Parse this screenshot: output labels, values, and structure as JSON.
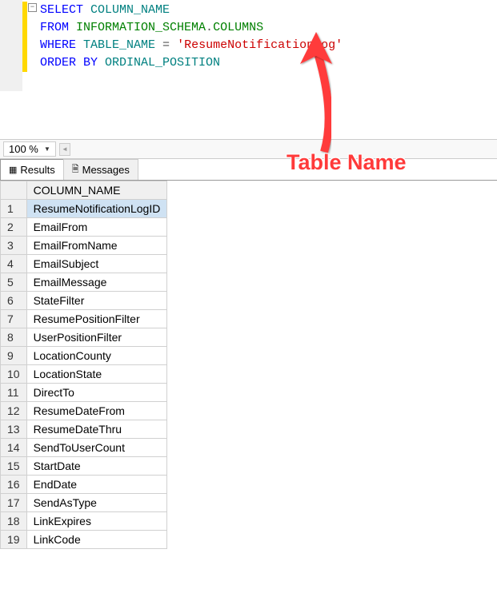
{
  "code": {
    "line1": {
      "select": "SELECT",
      "col": " COLUMN_NAME"
    },
    "line2": {
      "from": "FROM",
      "schema": " INFORMATION_SCHEMA",
      "dot": ".",
      "cols": "COLUMNS"
    },
    "line3": {
      "where": "WHERE",
      "tbl": " TABLE_NAME ",
      "eq": "=",
      "sp": " ",
      "str": "'ResumeNotificationLog'"
    },
    "line4": {
      "orderby": "ORDER BY",
      "ord": " ORDINAL_POSITION"
    }
  },
  "zoom": {
    "value": "100 %"
  },
  "tabs": {
    "results": "Results",
    "messages": "Messages"
  },
  "grid": {
    "header": "COLUMN_NAME",
    "rows": [
      {
        "num": "1",
        "val": "ResumeNotificationLogID"
      },
      {
        "num": "2",
        "val": "EmailFrom"
      },
      {
        "num": "3",
        "val": "EmailFromName"
      },
      {
        "num": "4",
        "val": "EmailSubject"
      },
      {
        "num": "5",
        "val": "EmailMessage"
      },
      {
        "num": "6",
        "val": "StateFilter"
      },
      {
        "num": "7",
        "val": "ResumePositionFilter"
      },
      {
        "num": "8",
        "val": "UserPositionFilter"
      },
      {
        "num": "9",
        "val": "LocationCounty"
      },
      {
        "num": "10",
        "val": "LocationState"
      },
      {
        "num": "11",
        "val": "DirectTo"
      },
      {
        "num": "12",
        "val": "ResumeDateFrom"
      },
      {
        "num": "13",
        "val": "ResumeDateThru"
      },
      {
        "num": "14",
        "val": "SendToUserCount"
      },
      {
        "num": "15",
        "val": "StartDate"
      },
      {
        "num": "16",
        "val": "EndDate"
      },
      {
        "num": "17",
        "val": "SendAsType"
      },
      {
        "num": "18",
        "val": "LinkExpires"
      },
      {
        "num": "19",
        "val": "LinkCode"
      }
    ]
  },
  "annotation": {
    "label": "Table Name"
  }
}
